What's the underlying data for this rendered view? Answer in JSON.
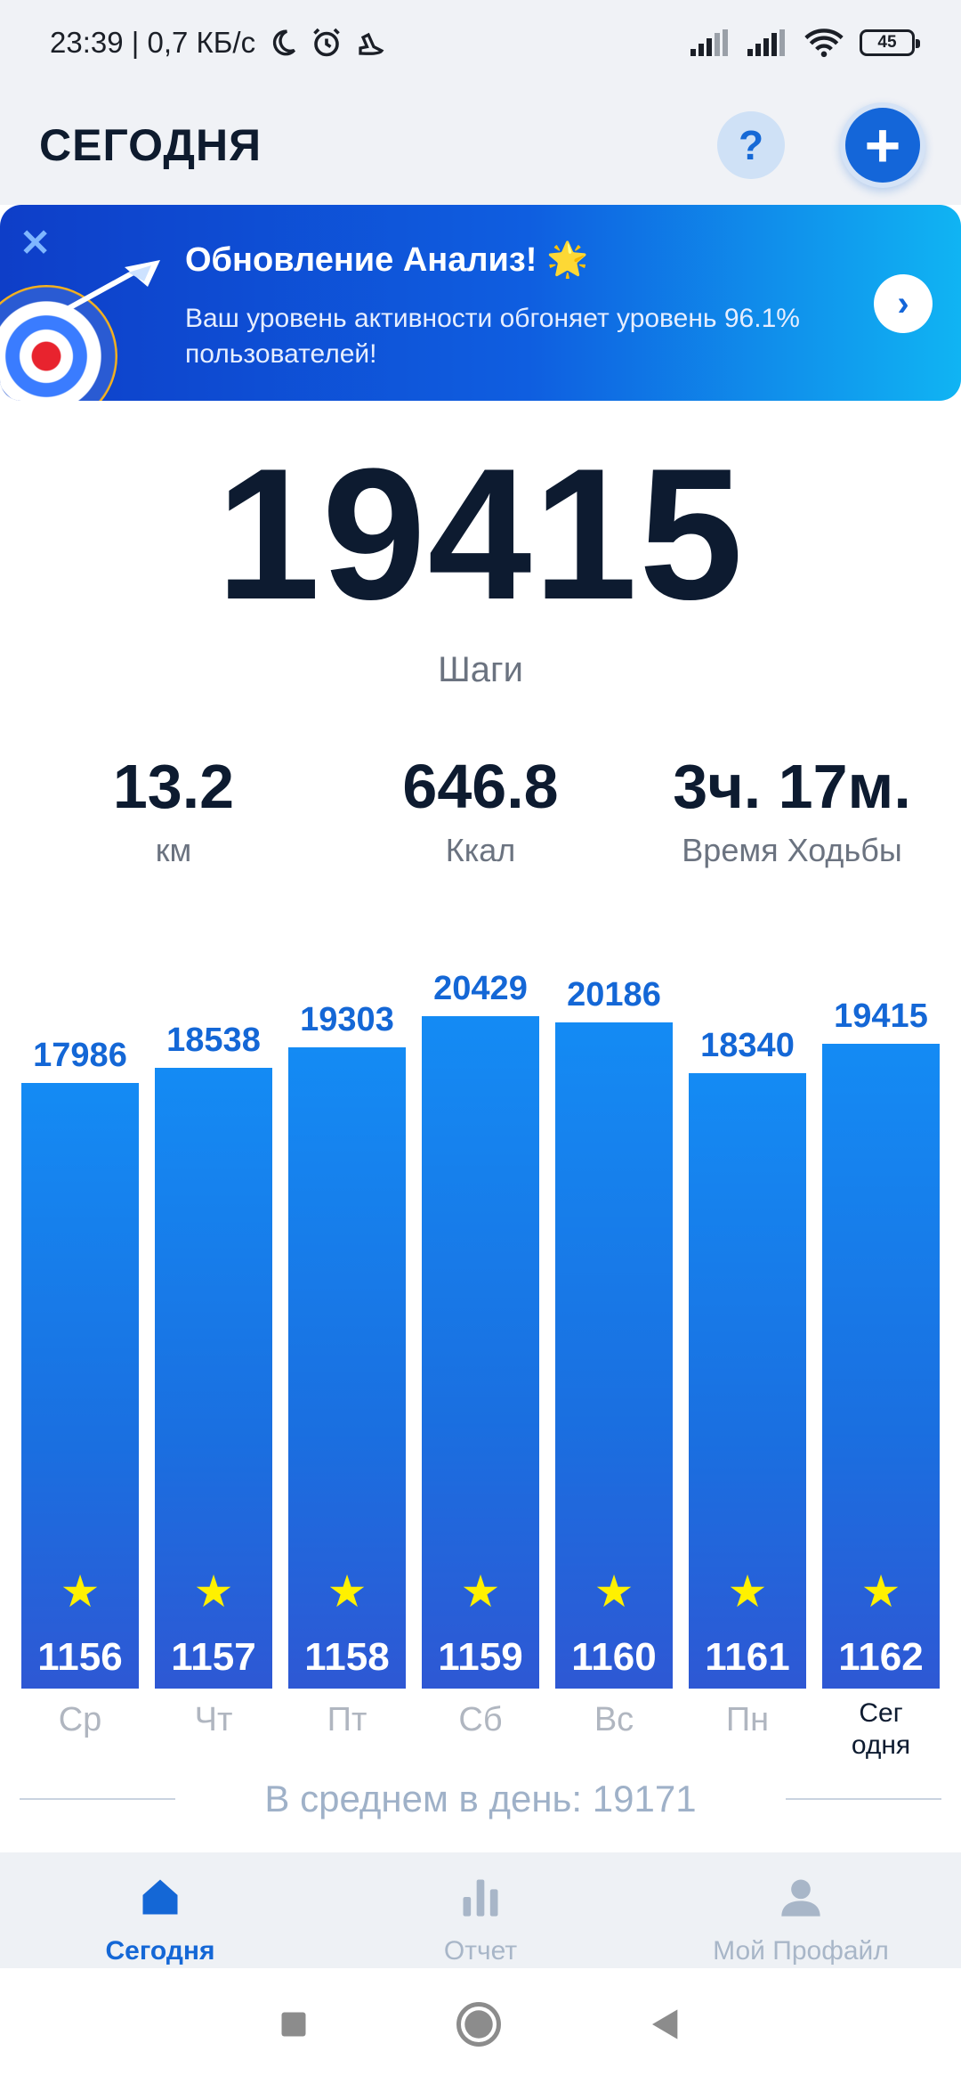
{
  "status_bar": {
    "time_speed": "23:39 | 0,7 КБ/с",
    "battery": "45",
    "icons": [
      "moon-icon",
      "alarm-icon",
      "shoe-icon",
      "signal-icon",
      "signal-icon",
      "wifi-icon",
      "battery-icon"
    ]
  },
  "header": {
    "title": "СЕГОДНЯ",
    "help_label": "?",
    "add_label": "+"
  },
  "banner": {
    "title": "Обновление Анализ! 🌟",
    "text": "Ваш уровень активности обгоняет уровень 96.1% пользователей!",
    "close_label": "✕",
    "arrow_label": "›"
  },
  "steps": {
    "value": "19415",
    "label": "Шаги"
  },
  "stats": [
    {
      "value": "13.2",
      "label": "км"
    },
    {
      "value": "646.8",
      "label": "Ккал"
    },
    {
      "value": "3ч. 17м.",
      "label": "Время Ходьбы"
    }
  ],
  "chart_data": {
    "type": "bar",
    "categories": [
      "Ср",
      "Чт",
      "Пт",
      "Сб",
      "Вс",
      "Пн",
      "Сег одня"
    ],
    "values": [
      17986,
      18538,
      19303,
      20429,
      20186,
      18340,
      19415
    ],
    "badges": [
      "1156",
      "1157",
      "1158",
      "1159",
      "1160",
      "1161",
      "1162"
    ],
    "labels": [
      "17986",
      "18538",
      "19303",
      "20429",
      "20186",
      "18340",
      "19415"
    ],
    "today_label_lines": [
      "Сег",
      "одня"
    ],
    "bar_color": "#1a7ae8",
    "value_color": "#1467d6"
  },
  "average": {
    "text": "В среднем в день: 19171"
  },
  "nav": {
    "items": [
      {
        "label": "Сегодня",
        "icon": "home-icon",
        "active": true
      },
      {
        "label": "Отчет",
        "icon": "bar-chart-icon",
        "active": false
      },
      {
        "label": "Мой Профайл",
        "icon": "profile-icon",
        "active": false
      }
    ]
  },
  "colors": {
    "accent": "#1466d9",
    "star": "#fff100",
    "background": "#f0f2f6"
  }
}
